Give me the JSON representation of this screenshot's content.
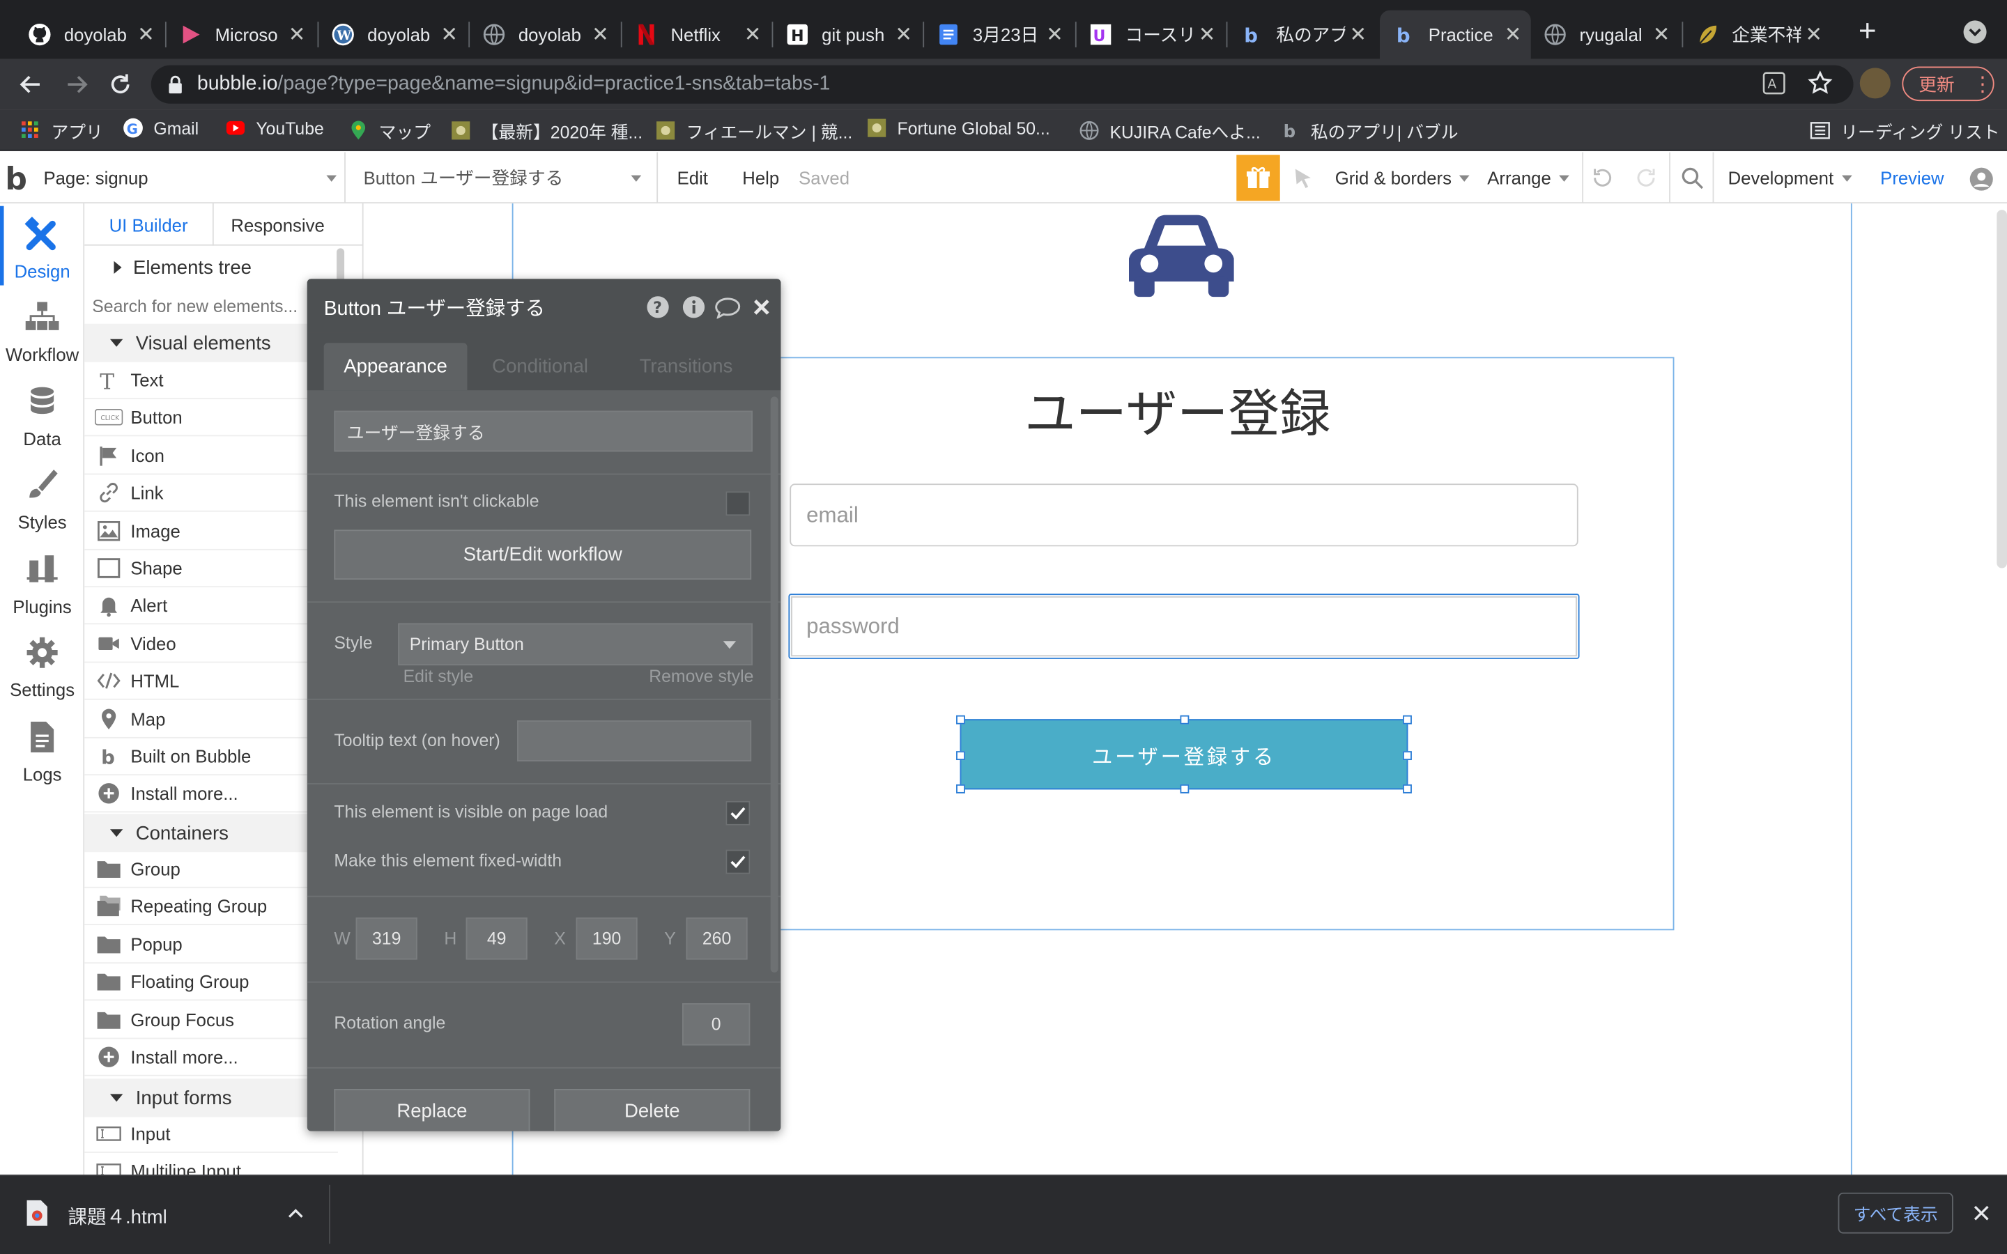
{
  "browser": {
    "tabs": [
      {
        "label": "doyolab",
        "icon": "github-icon"
      },
      {
        "label": "Microso",
        "icon": "play-icon"
      },
      {
        "label": "doyolab",
        "icon": "wordpress-icon"
      },
      {
        "label": "doyolab",
        "icon": "globe-icon"
      },
      {
        "label": "Netflix",
        "icon": "netflix-icon"
      },
      {
        "label": "git push",
        "icon": "hatena-icon"
      },
      {
        "label": "3月23日",
        "icon": "docs-icon"
      },
      {
        "label": "コースリ",
        "icon": "udemy-icon"
      },
      {
        "label": "私のアプ",
        "icon": "bubble-icon"
      },
      {
        "label": "Practice",
        "icon": "bubble-icon"
      },
      {
        "label": "ryugalal",
        "icon": "globe-icon"
      },
      {
        "label": "企業不祥",
        "icon": "leaf-icon"
      }
    ],
    "active_tab_index": 9,
    "url_host": "bubble.io",
    "url_path": "/page?type=page&name=signup&id=practice1-sns&tab=tabs-1",
    "update_label": "更新",
    "bookmarks": [
      {
        "label": "アプリ",
        "icon": "apps-grid-icon"
      },
      {
        "label": "Gmail",
        "icon": "google-icon"
      },
      {
        "label": "YouTube",
        "icon": "youtube-icon"
      },
      {
        "label": "マップ",
        "icon": "maps-icon"
      },
      {
        "label": "【最新】2020年 種...",
        "icon": "bookmark-icon"
      },
      {
        "label": "フィエールマン | 競...",
        "icon": "bookmark-icon"
      },
      {
        "label": "Fortune Global 50...",
        "icon": "bookmark-icon"
      },
      {
        "label": "KUJIRA Cafeへよ...",
        "icon": "globe-icon"
      },
      {
        "label": "私のアプリ| バブル",
        "icon": "bubble-icon"
      }
    ],
    "reading_list": "リーディング リスト"
  },
  "editor": {
    "page_selector": "Page: signup",
    "element_selector": "Button ユーザー登録する",
    "menu_edit": "Edit",
    "menu_help": "Help",
    "save_status": "Saved",
    "grid_borders": "Grid & borders",
    "arrange": "Arrange",
    "environment": "Development",
    "preview": "Preview"
  },
  "rail": [
    {
      "label": "Design",
      "icon": "design-icon"
    },
    {
      "label": "Workflow",
      "icon": "workflow-icon"
    },
    {
      "label": "Data",
      "icon": "database-icon"
    },
    {
      "label": "Styles",
      "icon": "brush-icon"
    },
    {
      "label": "Plugins",
      "icon": "plugin-icon"
    },
    {
      "label": "Settings",
      "icon": "gear-icon"
    },
    {
      "label": "Logs",
      "icon": "document-icon"
    }
  ],
  "panel": {
    "tab_ui_builder": "UI Builder",
    "tab_responsive": "Responsive",
    "elements_tree": "Elements tree",
    "search_placeholder": "Search for new elements...",
    "section_visual": "Visual elements",
    "visual_items": [
      {
        "label": "Text",
        "icon": "text-icon"
      },
      {
        "label": "Button",
        "icon": "button-icon"
      },
      {
        "label": "Icon",
        "icon": "flag-icon"
      },
      {
        "label": "Link",
        "icon": "link-icon"
      },
      {
        "label": "Image",
        "icon": "image-icon"
      },
      {
        "label": "Shape",
        "icon": "shape-icon"
      },
      {
        "label": "Alert",
        "icon": "bell-icon"
      },
      {
        "label": "Video",
        "icon": "video-icon"
      },
      {
        "label": "HTML",
        "icon": "code-icon"
      },
      {
        "label": "Map",
        "icon": "map-pin-icon"
      },
      {
        "label": "Built on Bubble",
        "icon": "bubble-icon"
      },
      {
        "label": "Install more...",
        "icon": "plus-circle-icon"
      }
    ],
    "section_containers": "Containers",
    "container_items": [
      {
        "label": "Group",
        "icon": "folder-icon"
      },
      {
        "label": "Repeating Group",
        "icon": "folder-stack-icon"
      },
      {
        "label": "Popup",
        "icon": "folder-icon"
      },
      {
        "label": "Floating Group",
        "icon": "folder-icon"
      },
      {
        "label": "Group Focus",
        "icon": "folder-icon"
      },
      {
        "label": "Install more...",
        "icon": "plus-circle-icon"
      }
    ],
    "section_inputs": "Input forms",
    "input_items": [
      {
        "label": "Input",
        "icon": "input-icon"
      },
      {
        "label": "Multiline Input",
        "icon": "input-icon"
      }
    ]
  },
  "property_editor": {
    "title": "Button ユーザー登録する",
    "tabs": [
      "Appearance",
      "Conditional",
      "Transitions"
    ],
    "button_text": "ユーザー登録する",
    "not_clickable_label": "This element isn't clickable",
    "not_clickable_checked": false,
    "workflow_button": "Start/Edit workflow",
    "style_label": "Style",
    "style_value": "Primary Button",
    "edit_style": "Edit style",
    "remove_style": "Remove style",
    "tooltip_label": "Tooltip text (on hover)",
    "tooltip_value": "",
    "visible_label": "This element is visible on page load",
    "visible_checked": true,
    "fixed_width_label": "Make this element fixed-width",
    "fixed_width_checked": true,
    "w_label": "W",
    "w_value": "319",
    "h_label": "H",
    "h_value": "49",
    "x_label": "X",
    "x_value": "190",
    "y_label": "Y",
    "y_value": "260",
    "rotation_label": "Rotation angle",
    "rotation_value": "0",
    "replace": "Replace",
    "delete": "Delete"
  },
  "canvas": {
    "logo_icon": "car-icon",
    "heading": "ユーザー登録",
    "email_placeholder": "email",
    "password_placeholder": "password",
    "signup_button": "ユーザー登録する",
    "button_color": "#4aadc8",
    "icon_color": "#3d4d8c"
  },
  "download_bar": {
    "file": "課題４.html",
    "show_all": "すべて表示"
  }
}
